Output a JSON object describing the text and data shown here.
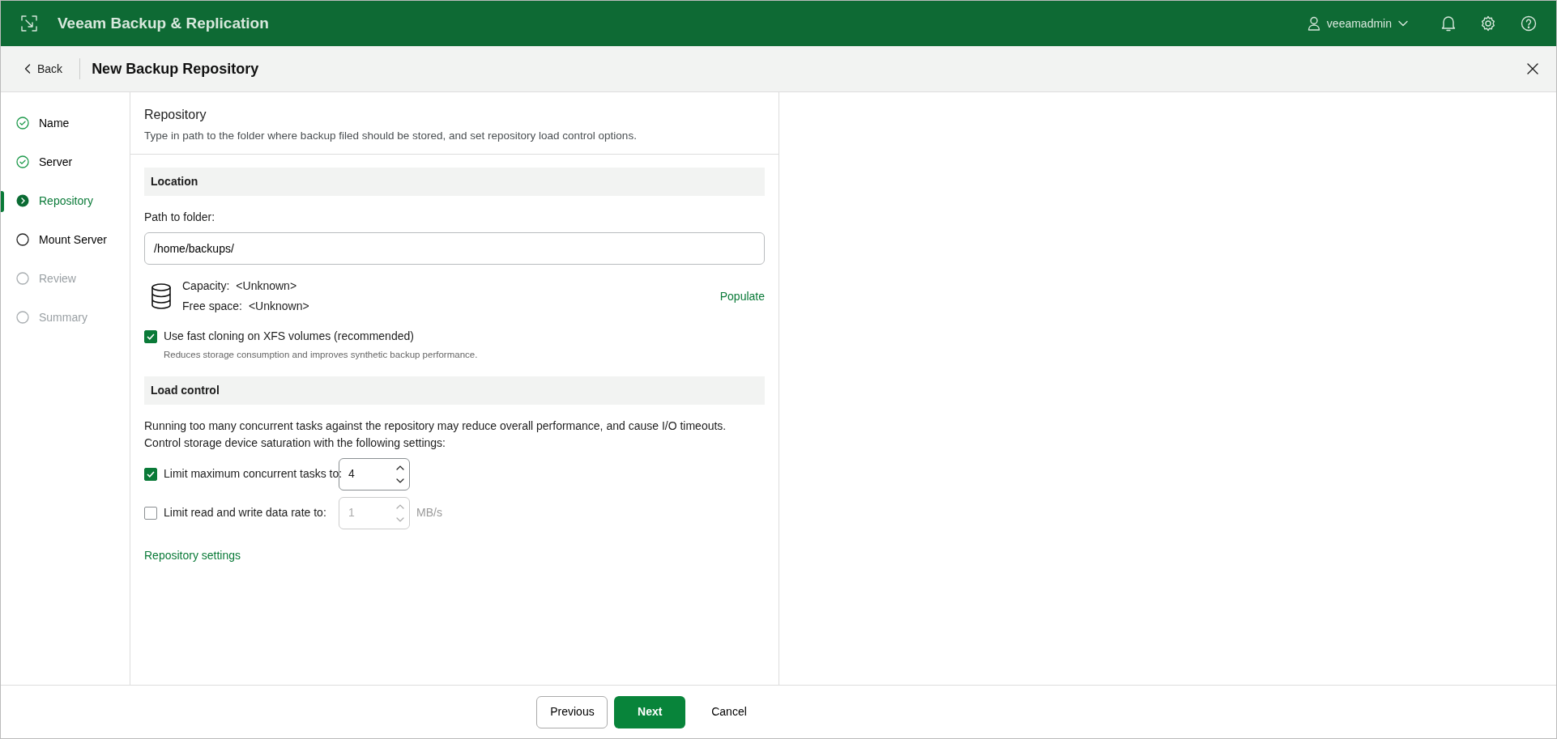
{
  "app": {
    "title": "Veeam Backup & Replication",
    "user": "veeamadmin"
  },
  "wizard": {
    "back": "Back",
    "title": "New Backup Repository"
  },
  "steps": [
    {
      "label": "Name",
      "kind": "done",
      "selected": false
    },
    {
      "label": "Server",
      "kind": "done",
      "selected": false
    },
    {
      "label": "Repository",
      "kind": "current",
      "selected": true
    },
    {
      "label": "Mount Server",
      "kind": "pending",
      "selected": false
    },
    {
      "label": "Review",
      "kind": "disabled",
      "selected": false
    },
    {
      "label": "Summary",
      "kind": "disabled",
      "selected": false
    }
  ],
  "page": {
    "title": "Repository",
    "description": "Type in path to the folder where backup filed should be stored, and set repository load control options."
  },
  "location": {
    "heading": "Location",
    "path_label": "Path to folder:",
    "path_value": "/home/backups/",
    "capacity_label": "Capacity:",
    "capacity_value": "<Unknown>",
    "free_label": "Free space:",
    "free_value": "<Unknown>",
    "populate": "Populate",
    "fast_cloning": {
      "label": "Use fast cloning on XFS volumes (recommended)",
      "checked": true,
      "hint": "Reduces storage consumption and improves synthetic backup performance."
    }
  },
  "load_control": {
    "heading": "Load control",
    "description": "Running too many concurrent tasks against the repository may reduce overall performance, and cause I/O timeouts. Control storage device saturation with the following settings:",
    "options": [
      {
        "label": "Limit maximum concurrent tasks to:",
        "checked": true,
        "value": "4"
      },
      {
        "label": "Limit read and write data rate to:",
        "checked": false,
        "value": "1",
        "unit": "MB/s"
      }
    ],
    "settings_link": "Repository settings"
  },
  "footer": {
    "previous": "Previous",
    "next": "Next",
    "cancel": "Cancel"
  }
}
